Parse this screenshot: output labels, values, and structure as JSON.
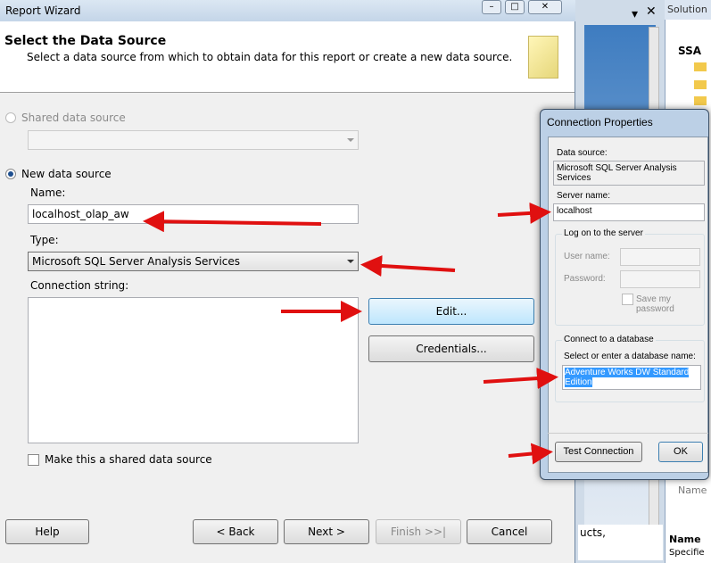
{
  "wizard": {
    "title": "Report Wizard",
    "heading": "Select the Data Source",
    "subheading": "Select a data source from which to obtain data for this report or create a new data source.",
    "shared_label": "Shared data source",
    "shared_value": "",
    "new_label": "New data source",
    "name_label": "Name:",
    "name_value": "localhost_olap_aw",
    "type_label": "Type:",
    "type_value": "Microsoft SQL Server Analysis Services",
    "conn_label": "Connection string:",
    "conn_value": "",
    "edit_label": "Edit...",
    "credentials_label": "Credentials...",
    "make_shared_label": "Make this a shared data source",
    "help": "Help",
    "back": "< Back",
    "next": "Next >",
    "finish": "Finish >>|",
    "cancel": "Cancel"
  },
  "background": {
    "solution_title": "Solution",
    "solution_root": "SSA",
    "partial_text": "ucts,",
    "props_name": "Name",
    "props_bold": "Name",
    "props_desc": "Specifie"
  },
  "conn": {
    "title": "Connection Properties",
    "ds_label": "Data source:",
    "ds_value": "Microsoft SQL Server Analysis Services",
    "server_label": "Server name:",
    "server_value": "localhost",
    "logon_group": "Log on to the server",
    "user_label": "User name:",
    "pwd_label": "Password:",
    "save_pwd": "Save my password",
    "db_group": "Connect to a database",
    "db_label": "Select or enter a database name:",
    "db_value": "Adventure Works DW Standard Edition",
    "test": "Test Connection",
    "ok": "OK"
  },
  "colors": {
    "arrow": "#e01010",
    "selection": "#3399ff"
  }
}
